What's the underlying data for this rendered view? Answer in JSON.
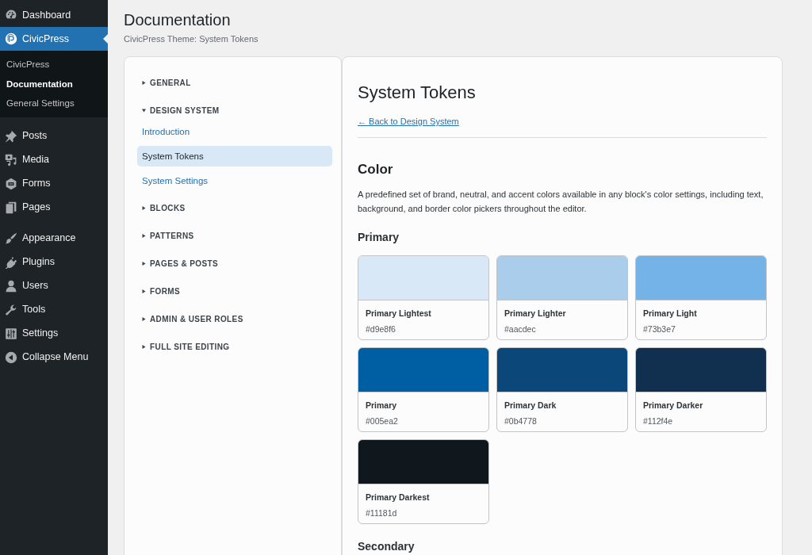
{
  "admin_menu": {
    "groups": [
      {
        "items": [
          {
            "label": "Dashboard",
            "selected": false
          },
          {
            "label": "CivicPress",
            "selected": true,
            "submenu": [
              {
                "label": "CivicPress",
                "selected": false
              },
              {
                "label": "Documentation",
                "selected": true
              },
              {
                "label": "General Settings",
                "selected": false
              }
            ]
          }
        ]
      },
      {
        "items": [
          {
            "label": "Posts",
            "selected": false
          },
          {
            "label": "Media",
            "selected": false
          },
          {
            "label": "Forms",
            "selected": false
          },
          {
            "label": "Pages",
            "selected": false
          }
        ]
      },
      {
        "items": [
          {
            "label": "Appearance",
            "selected": false
          },
          {
            "label": "Plugins",
            "selected": false
          },
          {
            "label": "Users",
            "selected": false
          },
          {
            "label": "Tools",
            "selected": false
          },
          {
            "label": "Settings",
            "selected": false
          }
        ]
      }
    ],
    "collapse_button": {
      "label": "Collapse Menu"
    }
  },
  "page": {
    "title": "Documentation",
    "subtitle": "CivicPress Theme: System Tokens"
  },
  "doc_nav": {
    "sections": [
      {
        "label": "GENERAL",
        "expanded": false
      },
      {
        "label": "DESIGN SYSTEM",
        "expanded": true,
        "children": [
          {
            "label": "Introduction",
            "selected": false
          },
          {
            "label": "System Tokens",
            "selected": true
          },
          {
            "label": "System Settings",
            "selected": false
          }
        ]
      },
      {
        "label": "BLOCKS",
        "expanded": false
      },
      {
        "label": "PATTERNS",
        "expanded": false
      },
      {
        "label": "PAGES & POSTS",
        "expanded": false
      },
      {
        "label": "FORMS",
        "expanded": false
      },
      {
        "label": "ADMIN & USER ROLES",
        "expanded": false
      },
      {
        "label": "FULL SITE EDITING",
        "expanded": false
      }
    ]
  },
  "content": {
    "title": "System Tokens",
    "back_link": "← Back to Design System",
    "sections": [
      {
        "heading": "Color",
        "description": "A predefined set of brand, neutral, and accent colors available in any block's color settings, including text, background, and border color pickers throughout the editor.",
        "groups": [
          {
            "heading": "Primary",
            "swatches": [
              {
                "name": "Primary Lightest",
                "value": "#d9e8f6",
                "color": "#d9e8f6"
              },
              {
                "name": "Primary Lighter",
                "value": "#aacdec",
                "color": "#aacdec"
              },
              {
                "name": "Primary Light",
                "value": "#73b3e7",
                "color": "#73b3e7"
              },
              {
                "name": "Primary",
                "value": "#005ea2",
                "color": "#005ea2"
              },
              {
                "name": "Primary Dark",
                "value": "#0b4778",
                "color": "#0b4778"
              },
              {
                "name": "Primary Darker",
                "value": "#112f4e",
                "color": "#112f4e"
              },
              {
                "name": "Primary Darkest",
                "value": "#11181d",
                "color": "#11181d"
              }
            ]
          },
          {
            "heading": "Secondary"
          }
        ]
      }
    ]
  }
}
